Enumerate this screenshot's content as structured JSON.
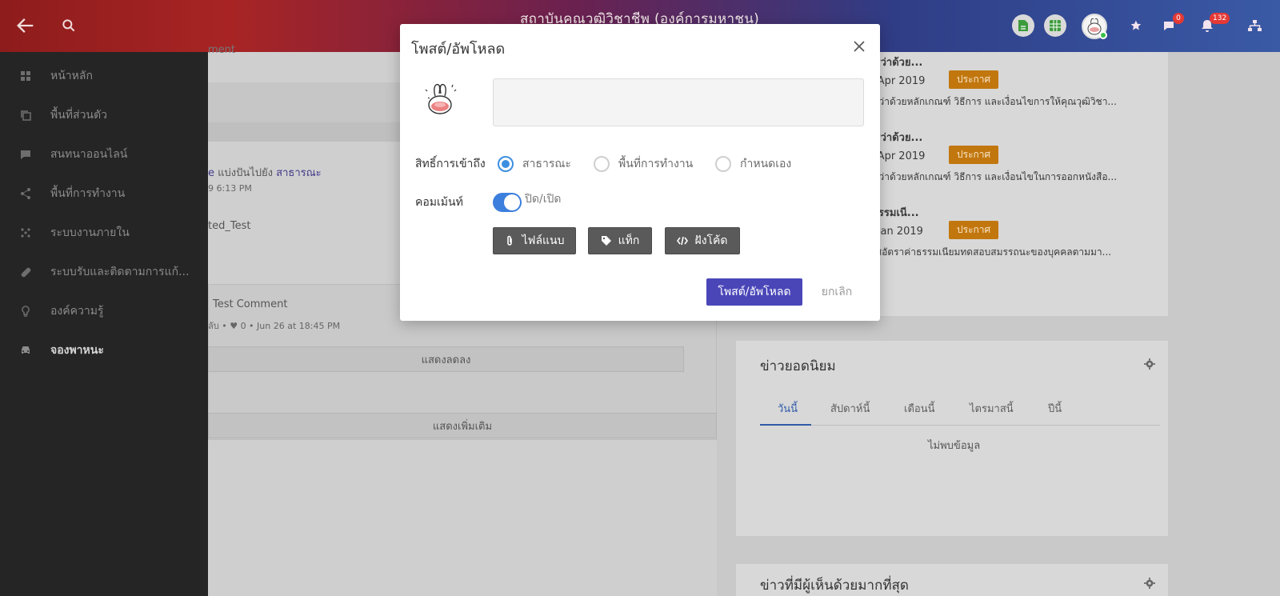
{
  "header": {
    "brand": "สถาบันคุณวุฒิวิชาชีพ (องค์การมหาชน)",
    "chat_count": "0",
    "notification_count": "132"
  },
  "sidebar": {
    "items": [
      {
        "label": "หน้าหลัก",
        "icon": "grid-icon"
      },
      {
        "label": "พื้นที่ส่วนตัว",
        "icon": "copy-icon"
      },
      {
        "label": "สนทนาออนไลน์",
        "icon": "chat-icon"
      },
      {
        "label": "พื้นที่การทำงาน",
        "icon": "share-icon"
      },
      {
        "label": "ระบบงานภายใน",
        "icon": "dots-icon"
      },
      {
        "label": "ระบบรับและติดตามการแก้...",
        "icon": "pill-icon"
      },
      {
        "label": "องค์ความรู้",
        "icon": "bulb-icon"
      },
      {
        "label": "จองพาหนะ",
        "icon": "car-icon"
      }
    ]
  },
  "feed": {
    "top_text": "ment",
    "share_prefix": "e",
    "share_text": "แบ่งปันไปยัง",
    "share_target": "สาธารณะ",
    "post_time": "9 6:13 PM",
    "post_body": "ted_Test",
    "comment_text": "Test Comment",
    "comment_meta": "ลับ  •  ♥ 0  •  Jun 26 at 18:45 PM",
    "show_less": "แสดงลดลง",
    "show_more": "แสดงเพิ่มเติม"
  },
  "announcements": [
    {
      "title": "นันซว่าด้วย...",
      "date": "15 Apr 2019",
      "tag": "ประกาศ",
      "desc": "นันซว่าด้วยหลักเกณฑ์ วิธีการ และเงื่อนไขการให้คุณวุฒิวิชา..."
    },
    {
      "title": "นันซว่าด้วย...",
      "date": "15 Apr 2019",
      "tag": "ประกาศ",
      "desc": "นันซว่าด้วยหลักเกณฑ์ วิธีการ และเงื่อนไขในการออกหนังสือ..."
    },
    {
      "title": "ค่าธรรมเนี...",
      "date": "24 Jan 2019",
      "tag": "ประกาศ",
      "desc": "ะกาศอัตราค่าธรรมเนียมทดสอบสมรรถนะของบุคคลตามมา..."
    }
  ],
  "popular": {
    "title": "ข่าวยอดนิยม",
    "tabs": [
      "วันนี้",
      "สัปดาห์นี้",
      "เดือนนี้",
      "ไตรมาสนี้",
      "ปีนี้"
    ],
    "active_tab": "วันนี้",
    "empty": "ไม่พบข้อมูล"
  },
  "most_agreed": {
    "title": "ข่าวที่มีผู้เห็นด้วยมากที่สุด"
  },
  "modal": {
    "title": "โพสต์/อัพโหลด",
    "input_placeholder": "",
    "access_label": "สิทธิ์การเข้าถึง",
    "access_options": [
      "สาธารณะ",
      "พื้นที่การทำงาน",
      "กำหนดเอง"
    ],
    "access_selected": "สาธารณะ",
    "comment_label": "คอมเม้นท์",
    "comment_toggle_label": "ปิด/เปิด",
    "comment_enabled": true,
    "attach_label": "ไฟล์แนบ",
    "tag_label": "แท็ก",
    "embed_label": "ฝังโค้ด",
    "submit_label": "โพสต์/อัพโหลด",
    "cancel_label": "ยกเลิก"
  },
  "colors": {
    "primary": "#4a46b8",
    "radio_accent": "#3c8fe0",
    "toggle_on": "#3c7fdd",
    "tag_bg": "#c2770e",
    "sidebar_bg": "#252525",
    "badge": "#e53935"
  }
}
